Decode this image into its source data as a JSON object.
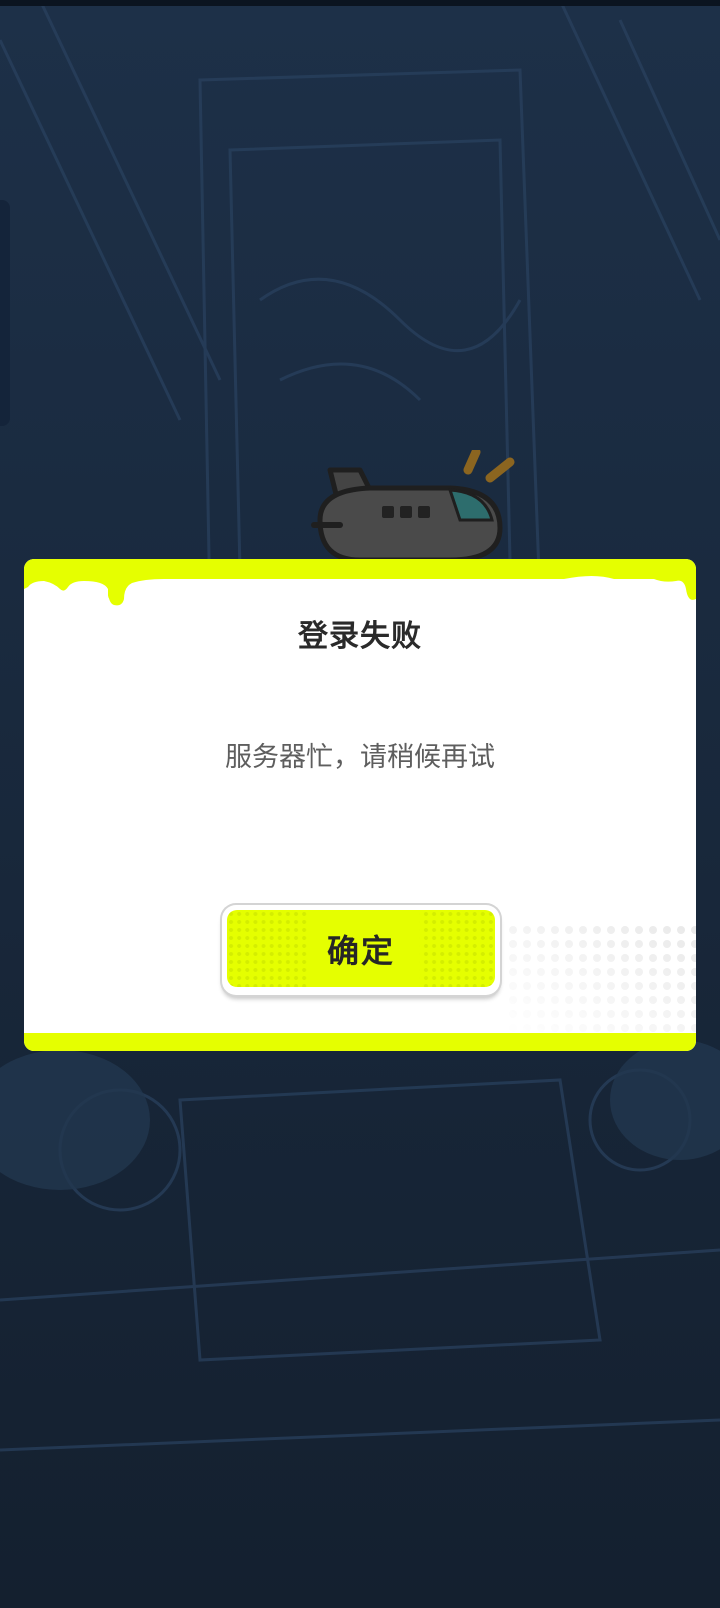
{
  "dialog": {
    "title": "登录失败",
    "message": "服务器忙，请稍候再试",
    "confirm_label": "确定"
  },
  "colors": {
    "background": "#1c3049",
    "accent": "#e5ff00",
    "dialog_bg": "#ffffff",
    "title_text": "#2a2a2a",
    "message_text": "#5e5e5e"
  },
  "icons": {
    "mascot": "airplane-icon"
  }
}
